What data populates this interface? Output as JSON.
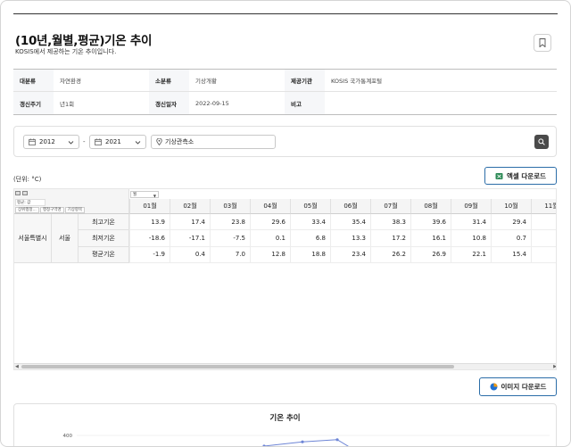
{
  "page": {
    "title": "(10년,월별,평균)기온 추이",
    "subtitle": "KOSIS에서 제공하는 기온 추이입니다."
  },
  "meta": {
    "rows": [
      [
        {
          "key": "대분류",
          "value": "자연환경"
        },
        {
          "key": "소분류",
          "value": "기상개황"
        },
        {
          "key": "제공기관",
          "value": "KOSIS 국가통계포털"
        }
      ],
      [
        {
          "key": "갱신주기",
          "value": "년1회"
        },
        {
          "key": "갱신일자",
          "value": "2022-09-15"
        },
        {
          "key": "비고",
          "value": ""
        }
      ]
    ]
  },
  "filter": {
    "start_year": "2012",
    "separator": "-",
    "end_year": "2021",
    "location": "기상관측소"
  },
  "table": {
    "unit": "(단위: °C)",
    "excel_button": "엑셀 다운로드",
    "pivot_stat_label": "평균: 값",
    "pivot_chips": [
      "상위행정...",
      "행정구역명",
      "기상항목"
    ],
    "column_dropdown": "월",
    "months": [
      "01월",
      "02월",
      "03월",
      "04월",
      "05월",
      "06월",
      "07월",
      "08월",
      "09월",
      "10월",
      "11월"
    ],
    "region_upper": "서울특별시",
    "region": "서울",
    "rows": [
      {
        "label": "최고기온",
        "values": [
          "13.9",
          "17.4",
          "23.8",
          "29.6",
          "33.4",
          "35.4",
          "38.3",
          "39.6",
          "31.4",
          "29.4",
          ""
        ]
      },
      {
        "label": "최저기온",
        "values": [
          "-18.6",
          "-17.1",
          "-7.5",
          "0.1",
          "6.8",
          "13.3",
          "17.2",
          "16.1",
          "10.8",
          "0.7",
          ""
        ]
      },
      {
        "label": "평균기온",
        "values": [
          "-1.9",
          "0.4",
          "7.0",
          "12.8",
          "18.8",
          "23.4",
          "26.2",
          "26.9",
          "22.1",
          "15.4",
          ""
        ]
      }
    ]
  },
  "image_button": "이미지 다운로드",
  "chart_data": {
    "type": "line",
    "title": "기온 추이",
    "y_ticks": [
      "400"
    ],
    "series": [
      {
        "values": [
          380,
          388,
          392
        ]
      }
    ]
  },
  "colors": {
    "accent_border": "#2b6da8",
    "series_line": "#6d85d6"
  }
}
